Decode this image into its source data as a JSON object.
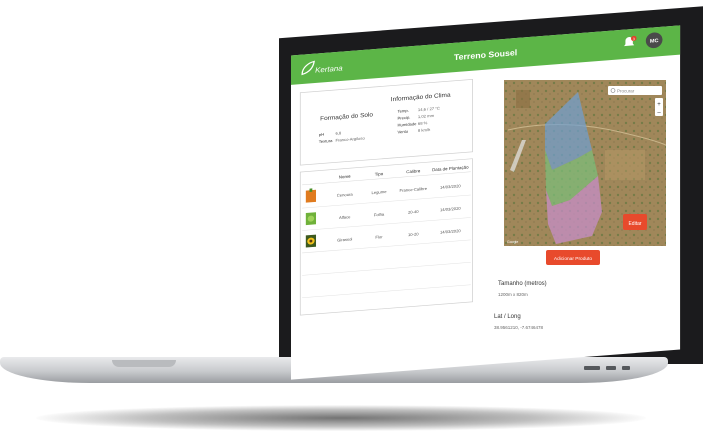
{
  "app": {
    "logo_text": "Kertana",
    "page_title": "Terreno Sousel",
    "notification_count": "3",
    "avatar_initials": "MC",
    "brand_color": "#5cb547"
  },
  "soil": {
    "title": "Formação do Solo",
    "rows": [
      {
        "label": "pH",
        "value": "6,8"
      },
      {
        "label": "Textura",
        "value": "Franco-Argiloso"
      }
    ]
  },
  "climate": {
    "title": "Informação do Clima",
    "rows": [
      {
        "label": "Temp.",
        "value": "14,6 / 27 °C"
      },
      {
        "label": "Precip.",
        "value": "1,02 mm"
      },
      {
        "label": "Humidade",
        "value": "68 %"
      },
      {
        "label": "Vento",
        "value": "8 km/h"
      }
    ]
  },
  "products": {
    "columns": [
      "Nome",
      "Tipo",
      "Calibre",
      "Data de Plantação"
    ],
    "rows": [
      {
        "name": "Cenoura",
        "type": "Legume",
        "caliber": "Franco-Calibre",
        "date": "14/03/2020"
      },
      {
        "name": "Alface",
        "type": "Folha",
        "caliber": "20-40",
        "date": "14/03/2020"
      },
      {
        "name": "Girassol",
        "type": "Flor",
        "caliber": "10-20",
        "date": "14/03/2020"
      }
    ]
  },
  "map": {
    "search_placeholder": "Procurar",
    "edit_label": "Editar",
    "attribution": "Google",
    "field_colors": [
      "#6f9fd0",
      "#7bbf7a",
      "#c88fcc"
    ]
  },
  "actions": {
    "add_product": "Adicionar Produto"
  },
  "terrain": {
    "size_label": "Tamanho (metros)",
    "size_value": "1200m x 820m",
    "coords_label": "Lat / Long",
    "coords_value": "38.9561210, -7.6746478"
  }
}
